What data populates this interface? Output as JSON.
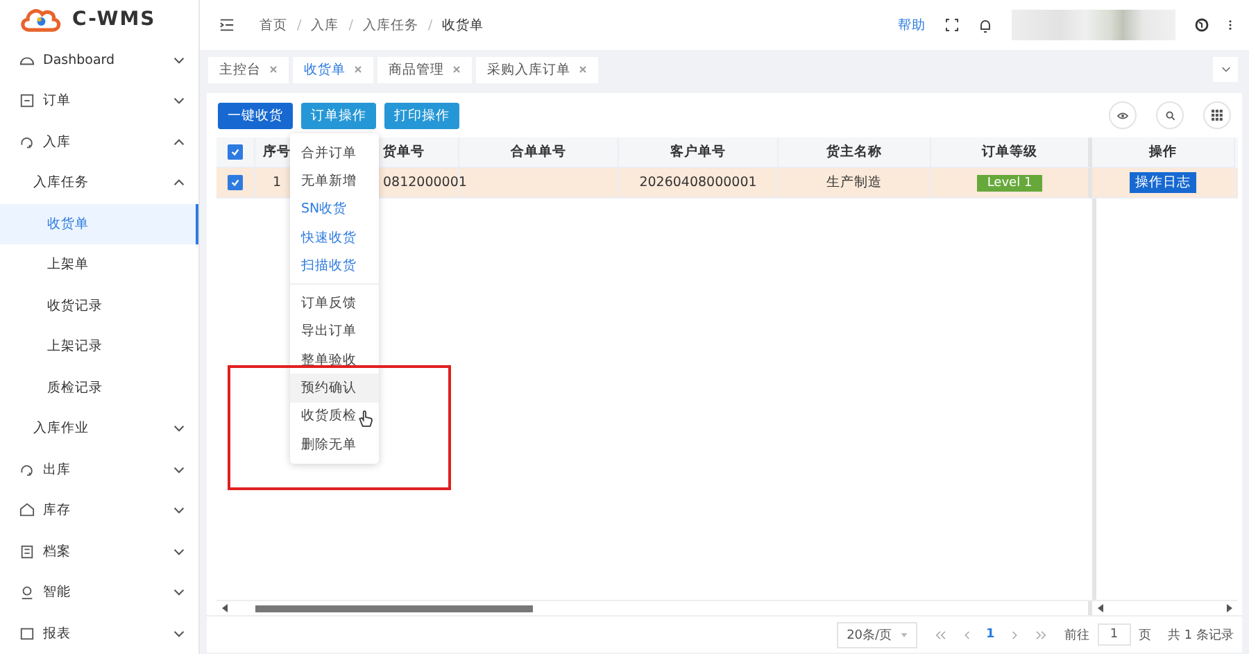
{
  "logo": {
    "text": "C-WMS"
  },
  "breadcrumb": [
    {
      "label": "首页"
    },
    {
      "separator": "/",
      "label": "入库"
    },
    {
      "separator": "/",
      "label": "入库任务"
    },
    {
      "separator": "/",
      "label": "收货单"
    }
  ],
  "header": {
    "help": "帮助"
  },
  "sidebar": {
    "items": [
      {
        "label": "Dashboard",
        "expanded": false,
        "selected": false
      },
      {
        "label": "订单",
        "expanded": false,
        "selected": false
      },
      {
        "label": "入库",
        "expanded": true,
        "selected": false,
        "children": [
          {
            "label": "入库任务",
            "expanded": true,
            "selected": false,
            "children": [
              {
                "label": "收货单",
                "selected": true
              },
              {
                "label": "上架单",
                "selected": false
              },
              {
                "label": "收货记录",
                "selected": false
              },
              {
                "label": "上架记录",
                "selected": false
              },
              {
                "label": "质检记录",
                "selected": false
              }
            ]
          },
          {
            "label": "入库作业",
            "expanded": false,
            "selected": false
          }
        ]
      },
      {
        "label": "出库",
        "expanded": false,
        "selected": false
      },
      {
        "label": "库存",
        "expanded": false,
        "selected": false
      },
      {
        "label": "档案",
        "expanded": false,
        "selected": false
      },
      {
        "label": "智能",
        "expanded": false,
        "selected": false
      },
      {
        "label": "报表",
        "expanded": false,
        "selected": false
      }
    ]
  },
  "tabs": [
    {
      "label": "主控台",
      "selected": false
    },
    {
      "label": "收货单",
      "selected": true
    },
    {
      "label": "商品管理",
      "selected": false
    },
    {
      "label": "采购入库订单",
      "selected": false
    }
  ],
  "toolbar": {
    "buttons": [
      {
        "label": "一键收货",
        "kind": "primary"
      },
      {
        "label": "订单操作",
        "kind": "info"
      },
      {
        "label": "打印操作",
        "kind": "info"
      }
    ]
  },
  "dropdown": {
    "groups": [
      [
        {
          "label": "合并订单",
          "kind": "normal",
          "hovered": false
        },
        {
          "label": "无单新增",
          "kind": "normal",
          "hovered": false
        },
        {
          "label": "SN收货",
          "kind": "link",
          "hovered": false
        },
        {
          "label": "快速收货",
          "kind": "link",
          "hovered": false
        },
        {
          "label": "扫描收货",
          "kind": "link",
          "hovered": false
        }
      ],
      [
        {
          "label": "订单反馈",
          "kind": "normal",
          "hovered": false
        },
        {
          "label": "导出订单",
          "kind": "normal",
          "hovered": false
        },
        {
          "label": "整单验收",
          "kind": "normal",
          "hovered": false
        },
        {
          "label": "预约确认",
          "kind": "normal",
          "hovered": true
        },
        {
          "label": "收货质检",
          "kind": "normal",
          "hovered": false
        },
        {
          "label": "删除无单",
          "kind": "normal",
          "hovered": false
        }
      ]
    ]
  },
  "table": {
    "header_checked": true,
    "columns": [
      "序号",
      "货单号",
      "合单单号",
      "客户单号",
      "货主名称",
      "订单等级",
      "操作"
    ],
    "rows": [
      {
        "checked": true,
        "cells": [
          "1",
          "0812000001",
          "",
          "20260408000001",
          "生产制造"
        ],
        "level": "Level 1",
        "action": "操作日志"
      }
    ]
  },
  "pagination": {
    "page_size": "20条/页",
    "current": "1",
    "goto_label": "前往",
    "goto_value": "1",
    "page_unit": "页",
    "total": "共 1 条记录"
  }
}
